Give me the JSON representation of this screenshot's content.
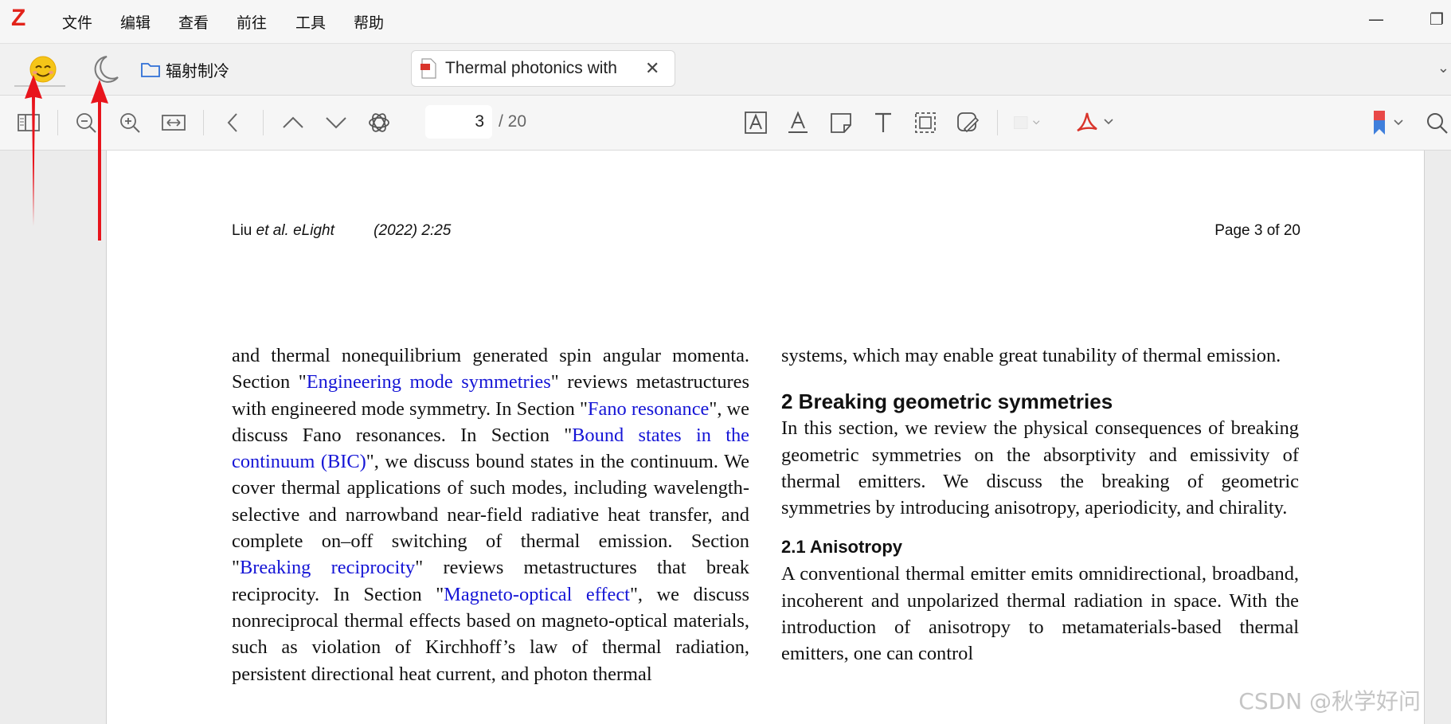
{
  "menubar": {
    "logo": "Z",
    "items": [
      "文件",
      "编辑",
      "查看",
      "前往",
      "工具",
      "帮助"
    ],
    "minimize": "—",
    "restore": "❐"
  },
  "tabbar": {
    "folder_label": "辐射制冷",
    "tab_title": "Thermal photonics with",
    "tab_close": "✕"
  },
  "toolbar": {
    "page_current": "3",
    "page_total": "/ 20"
  },
  "document": {
    "header_author": "Liu",
    "header_etal": "et al. eLight",
    "header_year": "(2022) 2:25",
    "header_page": "Page 3 of 20",
    "left_col": {
      "t1": "and thermal nonequilibrium generated spin angular momenta. Section \"",
      "l1": "Engineering mode symmetries",
      "t2": "\" reviews metastructures with engineered mode symmetry. In Section \"",
      "l2": "Fano resonance",
      "t3": "\", we discuss Fano resonances. In Section \"",
      "l3": "Bound states in the continuum (BIC)",
      "t4": "\", we discuss bound states in the continuum. We cover thermal applications of such modes, including wavelength-selective and narrowband near-field radiative heat transfer, and complete on–off switching of thermal emission. Section \"",
      "l4": "Breaking reciprocity",
      "t5": "\" reviews metastructures that break reciprocity. In Section \"",
      "l5": "Magneto-optical effect",
      "t6": "\", we discuss nonreciprocal thermal effects based on magneto-optical materials, such as violation of Kirchhoff’s law of thermal radiation, persistent directional heat current, and photon thermal"
    },
    "right_col": {
      "p1": "systems, which may enable great tunability of thermal emission.",
      "h2": "2  Breaking geometric symmetries",
      "p2": "In this section, we review the physical consequences of breaking geometric symmetries on the absorptivity and emissivity of thermal emitters. We discuss the breaking of geometric symmetries by introducing anisotropy, aperiodicity, and chirality.",
      "h3": "2.1  Anisotropy",
      "p3": "A conventional thermal emitter emits omnidirectional, broadband, incoherent and unpolarized thermal radiation in space. With the introduction of anisotropy to metamaterials-based thermal emitters, one can control"
    },
    "watermark": "CSDN @秋学好问"
  },
  "colors": {
    "accent_red": "#e2231a",
    "link_blue": "#1515d6",
    "sun_yellow": "#f5c518"
  },
  "icons": [
    "sidebar-toggle-icon",
    "zoom-out-icon",
    "zoom-in-icon",
    "fit-width-icon",
    "back-icon",
    "previous-page-icon",
    "next-page-icon",
    "openai-icon",
    "highlight-text-icon",
    "underline-text-icon",
    "note-icon",
    "text-icon",
    "select-area-icon",
    "draw-icon",
    "color-picker-icon",
    "pdf-tools-icon",
    "bookmark-icon",
    "search-icon"
  ]
}
